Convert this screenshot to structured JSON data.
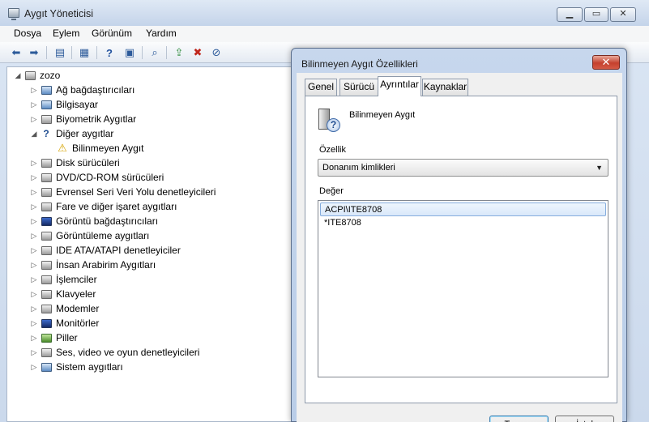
{
  "window": {
    "title": "Aygıt Yöneticisi",
    "caption_buttons": [
      "▁",
      "▭",
      "✕"
    ]
  },
  "menu": [
    "Dosya",
    "Eylem",
    "Görünüm",
    "Yardım"
  ],
  "toolbar": {
    "buttons": [
      "back-icon",
      "forward-icon",
      "console-tree-icon",
      "properties-icon",
      "help-icon",
      "view-icon",
      "scan-hardware-icon",
      "update-driver-icon",
      "uninstall-icon",
      "disable-icon"
    ]
  },
  "tree": {
    "root": "zozo",
    "items": [
      {
        "label": "Ağ bağdaştırıcıları",
        "icon": "network-adapter-icon",
        "expander": "▷"
      },
      {
        "label": "Bilgisayar",
        "icon": "computer-icon",
        "expander": "▷"
      },
      {
        "label": "Biyometrik Aygıtlar",
        "icon": "fingerprint-icon",
        "expander": "▷"
      },
      {
        "label": "Diğer aygıtlar",
        "icon": "unknown-device-icon",
        "expander": "◢"
      },
      {
        "label": "Bilinmeyen Aygıt",
        "icon": "warning-device-icon",
        "expander": ""
      },
      {
        "label": "Disk sürücüleri",
        "icon": "disk-drive-icon",
        "expander": "▷"
      },
      {
        "label": "DVD/CD-ROM sürücüleri",
        "icon": "dvd-drive-icon",
        "expander": "▷"
      },
      {
        "label": "Evrensel Seri Veri Yolu denetleyicileri",
        "icon": "usb-icon",
        "expander": "▷"
      },
      {
        "label": "Fare ve diğer işaret aygıtları",
        "icon": "mouse-icon",
        "expander": "▷"
      },
      {
        "label": "Görüntü bağdaştırıcıları",
        "icon": "display-adapter-icon",
        "expander": "▷"
      },
      {
        "label": "Görüntüleme aygıtları",
        "icon": "camera-icon",
        "expander": "▷"
      },
      {
        "label": "IDE ATA/ATAPI denetleyiciler",
        "icon": "ide-controller-icon",
        "expander": "▷"
      },
      {
        "label": "İnsan Arabirim Aygıtları",
        "icon": "hid-icon",
        "expander": "▷"
      },
      {
        "label": "İşlemciler",
        "icon": "processor-icon",
        "expander": "▷"
      },
      {
        "label": "Klavyeler",
        "icon": "keyboard-icon",
        "expander": "▷"
      },
      {
        "label": "Modemler",
        "icon": "modem-icon",
        "expander": "▷"
      },
      {
        "label": "Monitörler",
        "icon": "monitor-icon",
        "expander": "▷"
      },
      {
        "label": "Piller",
        "icon": "battery-icon",
        "expander": "▷"
      },
      {
        "label": "Ses, video ve oyun denetleyicileri",
        "icon": "speaker-icon",
        "expander": "▷"
      },
      {
        "label": "Sistem aygıtları",
        "icon": "system-device-icon",
        "expander": "▷"
      }
    ]
  },
  "dialog": {
    "title": "Bilinmeyen Aygıt Özellikleri",
    "close_glyph": "✕",
    "tabs": [
      "Genel",
      "Sürücü",
      "Ayrıntılar",
      "Kaynaklar"
    ],
    "active_tab": "Ayrıntılar",
    "device_name": "Bilinmeyen Aygıt",
    "property_label": "Özellik",
    "property_value": "Donanım kimlikleri",
    "value_label": "Değer",
    "values": [
      "ACPI\\ITE8708",
      "*ITE8708"
    ],
    "ok_label": "Tamam",
    "cancel_label": "İptal"
  },
  "colors": {
    "title_bar": "#cfdcee",
    "selection_border": "#84acdd",
    "close_button": "#c5402e"
  }
}
